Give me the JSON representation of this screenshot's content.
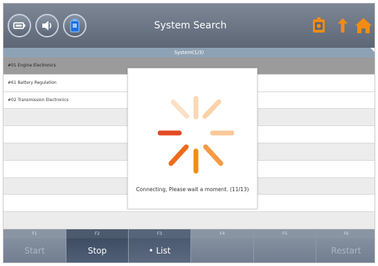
{
  "header": {
    "title": "System Search",
    "left_icons": [
      "battery-icon",
      "speaker-icon",
      "vehicle-connector-icon"
    ],
    "right_icons": [
      "tablet-icon",
      "back-upload-icon",
      "home-icon"
    ],
    "accent_color": "#f28c12"
  },
  "list": {
    "column_header": "System(1/3)",
    "rows": [
      {
        "label": "#01 Engine Electronics",
        "state": "selected"
      },
      {
        "label": "#61 Battery Regulation",
        "state": "normal"
      },
      {
        "label": "#02 Transmission Electronics",
        "state": "normal"
      },
      {
        "label": "",
        "state": "empty"
      },
      {
        "label": "",
        "state": "empty"
      },
      {
        "label": "",
        "state": "empty"
      },
      {
        "label": "",
        "state": "empty"
      },
      {
        "label": "",
        "state": "empty"
      },
      {
        "label": "",
        "state": "empty"
      },
      {
        "label": "",
        "state": "empty"
      }
    ]
  },
  "dialog": {
    "message": "Connecting, Please wait a moment. (11/13)",
    "spinner_icon": "loading-spinner-icon"
  },
  "function_keys": [
    {
      "num": "F1",
      "label": "Start",
      "state": "disabled"
    },
    {
      "num": "F2",
      "label": "Stop",
      "state": "active"
    },
    {
      "num": "F3",
      "label": "• List",
      "state": "active2"
    },
    {
      "num": "F4",
      "label": "",
      "state": "normal"
    },
    {
      "num": "F5",
      "label": "",
      "state": "normal"
    },
    {
      "num": "F6",
      "label": "Restart",
      "state": "disabled"
    }
  ]
}
